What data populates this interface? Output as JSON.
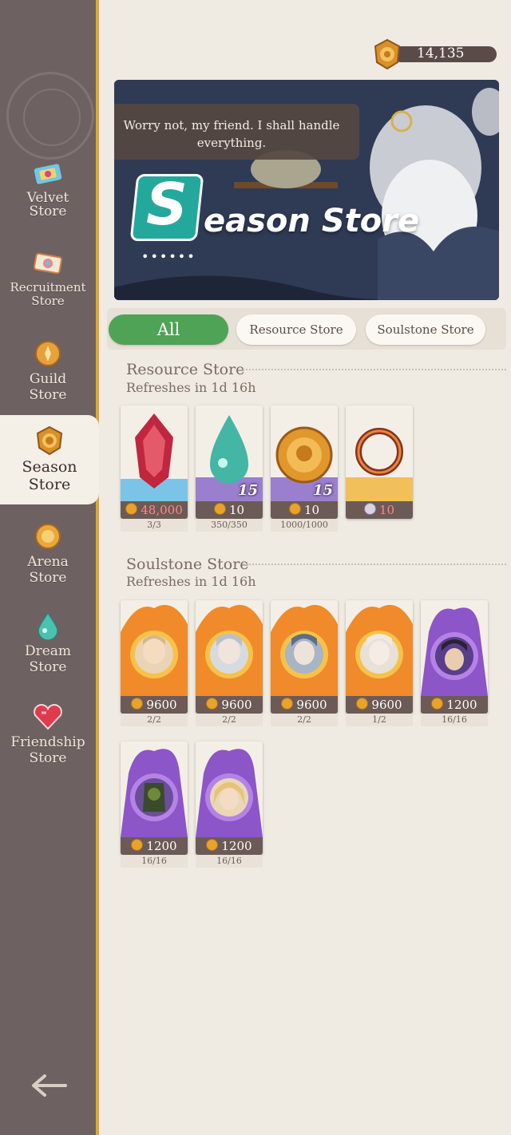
{
  "sidebar": {
    "items": [
      {
        "label_1": "Velvet",
        "label_2": "Store",
        "icon": "velvet-ticket-icon"
      },
      {
        "label_1": "Recruitment",
        "label_2": "Store",
        "icon": "recruitment-ticket-icon"
      },
      {
        "label_1": "Guild",
        "label_2": "Store",
        "icon": "guild-emblem-icon"
      },
      {
        "label_1": "Season",
        "label_2": "Store",
        "icon": "season-coin-icon",
        "active": true
      },
      {
        "label_1": "Arena",
        "label_2": "Store",
        "icon": "arena-coin-icon"
      },
      {
        "label_1": "Dream",
        "label_2": "Store",
        "icon": "dream-drop-icon"
      },
      {
        "label_1": "Friendship",
        "label_2": "Store",
        "icon": "heart-gem-icon"
      }
    ],
    "back_icon": "back-arrow-icon"
  },
  "currency": {
    "amount": "14,135",
    "icon": "season-coin-icon"
  },
  "banner": {
    "speech": "Worry not, my friend. I shall handle everything.",
    "logo_letter": "S",
    "title": "eason Store",
    "dots": "••••••"
  },
  "tabs": [
    {
      "label": "All",
      "active": true
    },
    {
      "label": "Resource Store",
      "active": false
    },
    {
      "label": "Soulstone Store",
      "active": false
    }
  ],
  "resource_store": {
    "title": "Resource Store",
    "refresh": "Refreshes in 1d 16h",
    "items": [
      {
        "price": "48,000",
        "limit": "3/3",
        "art": "red-crystal",
        "price_red": true
      },
      {
        "price": "10",
        "limit": "350/350",
        "art": "teal-drop",
        "qty": "15"
      },
      {
        "price": "10",
        "limit": "1000/1000",
        "art": "gold-coin",
        "qty": "15"
      },
      {
        "price": "10",
        "limit": "",
        "art": "ring",
        "price_red": true
      }
    ]
  },
  "soulstone_store": {
    "title": "Soulstone Store",
    "refresh": "Refreshes in 1d 16h",
    "items": [
      {
        "price": "9600",
        "limit": "2/2",
        "art": "fire"
      },
      {
        "price": "9600",
        "limit": "2/2",
        "art": "fire"
      },
      {
        "price": "9600",
        "limit": "2/2",
        "art": "fire"
      },
      {
        "price": "9600",
        "limit": "1/2",
        "art": "fire"
      },
      {
        "price": "1200",
        "limit": "16/16",
        "art": "purple"
      },
      {
        "price": "1200",
        "limit": "16/16",
        "art": "purple"
      },
      {
        "price": "1200",
        "limit": "16/16",
        "art": "purple"
      }
    ]
  },
  "colors": {
    "accent_green": "#4ea356",
    "sidebar_bg": "#6e6161",
    "gold_border": "#e0a437"
  }
}
